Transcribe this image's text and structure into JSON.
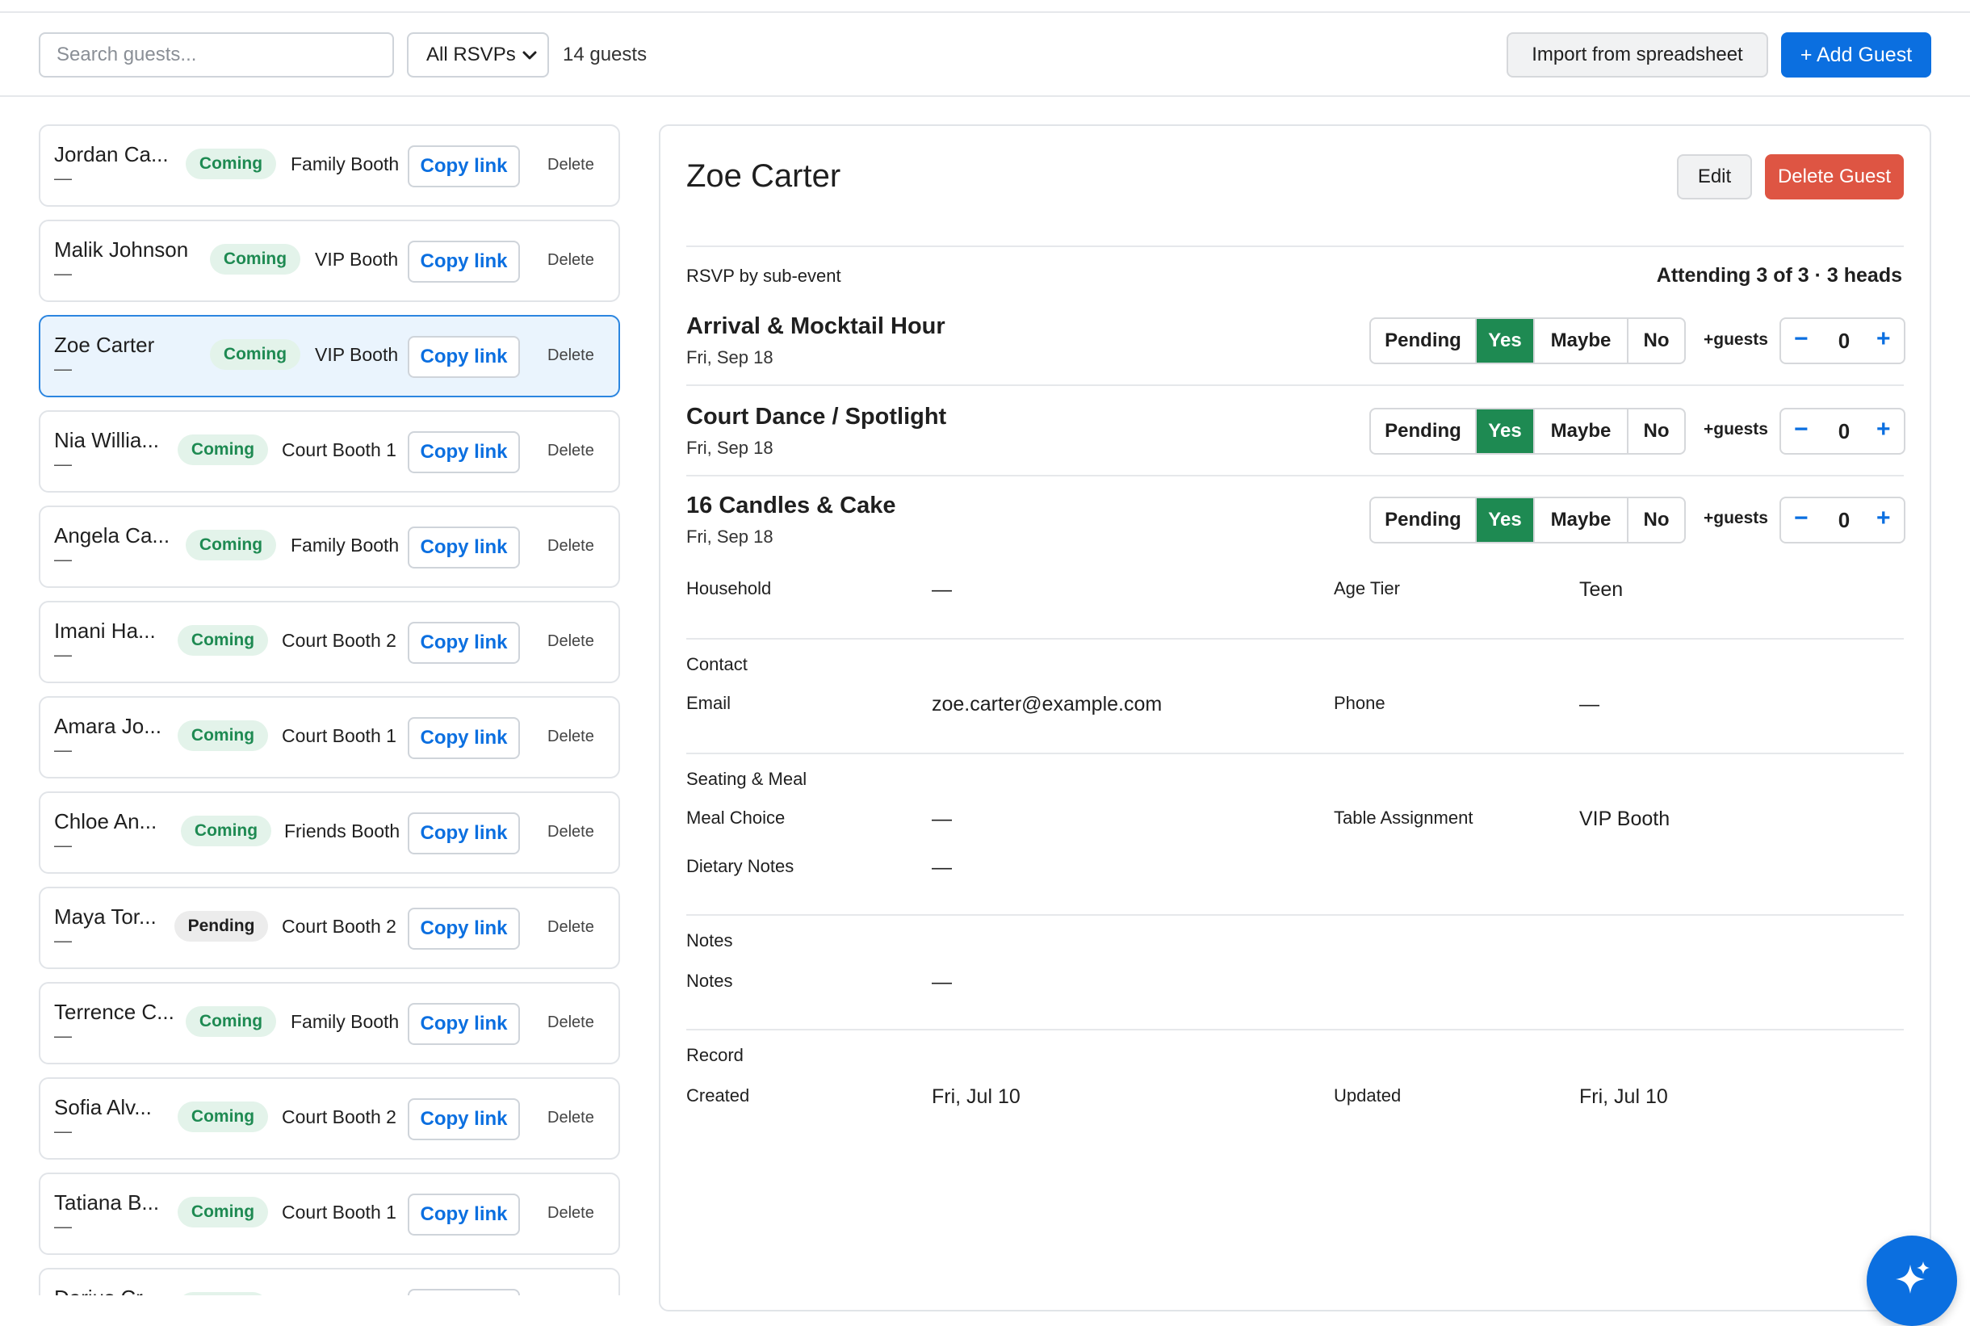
{
  "toolbar": {
    "search_placeholder": "Search guests...",
    "filter_value": "All RSVPs",
    "guest_count": "14 guests",
    "import_label": "Import from spreadsheet",
    "add_label": "+ Add Guest"
  },
  "guests": [
    {
      "name": "Jordan Ca...",
      "sub": "—",
      "status": "Coming",
      "table": "Family Booth",
      "copy": "Copy link",
      "delete": "Delete"
    },
    {
      "name": "Malik Johnson",
      "sub": "—",
      "status": "Coming",
      "table": "VIP Booth",
      "copy": "Copy link",
      "delete": "Delete"
    },
    {
      "name": "Zoe Carter",
      "sub": "—",
      "status": "Coming",
      "table": "VIP Booth",
      "copy": "Copy link",
      "delete": "Delete"
    },
    {
      "name": "Nia Willia...",
      "sub": "—",
      "status": "Coming",
      "table": "Court Booth 1",
      "copy": "Copy link",
      "delete": "Delete"
    },
    {
      "name": "Angela Ca...",
      "sub": "—",
      "status": "Coming",
      "table": "Family Booth",
      "copy": "Copy link",
      "delete": "Delete"
    },
    {
      "name": "Imani Ha...",
      "sub": "—",
      "status": "Coming",
      "table": "Court Booth 2",
      "copy": "Copy link",
      "delete": "Delete"
    },
    {
      "name": "Amara Jo...",
      "sub": "—",
      "status": "Coming",
      "table": "Court Booth 1",
      "copy": "Copy link",
      "delete": "Delete"
    },
    {
      "name": "Chloe An...",
      "sub": "—",
      "status": "Coming",
      "table": "Friends Booth",
      "copy": "Copy link",
      "delete": "Delete"
    },
    {
      "name": "Maya Tor...",
      "sub": "—",
      "status": "Pending",
      "table": "Court Booth 2",
      "copy": "Copy link",
      "delete": "Delete"
    },
    {
      "name": "Terrence C...",
      "sub": "—",
      "status": "Coming",
      "table": "Family Booth",
      "copy": "Copy link",
      "delete": "Delete"
    },
    {
      "name": "Sofia Alv...",
      "sub": "—",
      "status": "Coming",
      "table": "Court Booth 2",
      "copy": "Copy link",
      "delete": "Delete"
    },
    {
      "name": "Tatiana B...",
      "sub": "—",
      "status": "Coming",
      "table": "Court Booth 1",
      "copy": "Copy link",
      "delete": "Delete"
    },
    {
      "name": "Darius Cr...",
      "sub": "",
      "status": "",
      "table": "",
      "copy": "",
      "delete": ""
    }
  ],
  "detail": {
    "name": "Zoe Carter",
    "edit_label": "Edit",
    "delete_label": "Delete Guest",
    "rsvp_heading": "RSVP by sub-event",
    "attending_summary": "Attending 3 of 3 · 3 heads",
    "rsvp_options": {
      "pending": "Pending",
      "yes": "Yes",
      "maybe": "Maybe",
      "no": "No"
    },
    "plus_guests_label": "+guests",
    "events": [
      {
        "title": "Arrival & Mocktail Hour",
        "date": "Fri, Sep 18",
        "selected": "Yes",
        "plus_guests": "0"
      },
      {
        "title": "Court Dance / Spotlight",
        "date": "Fri, Sep 18",
        "selected": "Yes",
        "plus_guests": "0"
      },
      {
        "title": "16 Candles & Cake",
        "date": "Fri, Sep 18",
        "selected": "Yes",
        "plus_guests": "0"
      }
    ],
    "household_label": "Household",
    "household_value": "—",
    "age_tier_label": "Age Tier",
    "age_tier_value": "Teen",
    "contact_heading": "Contact",
    "email_label": "Email",
    "email_value": "zoe.carter@example.com",
    "phone_label": "Phone",
    "phone_value": "—",
    "seating_heading": "Seating & Meal",
    "meal_label": "Meal Choice",
    "meal_value": "—",
    "table_label": "Table Assignment",
    "table_value": "VIP Booth",
    "dietary_label": "Dietary Notes",
    "dietary_value": "—",
    "notes_heading": "Notes",
    "notes_label": "Notes",
    "notes_value": "—",
    "record_heading": "Record",
    "created_label": "Created",
    "created_value": "Fri, Jul 10",
    "updated_label": "Updated",
    "updated_value": "Fri, Jul 10"
  },
  "colors": {
    "accent": "#0b6fe0",
    "danger": "#de5543",
    "coming": "#1e8a52",
    "selected_bg": "#eaf4fd"
  },
  "icons": {
    "filter_chevron": "chevron-down-icon",
    "fab": "sparkle-icon"
  }
}
